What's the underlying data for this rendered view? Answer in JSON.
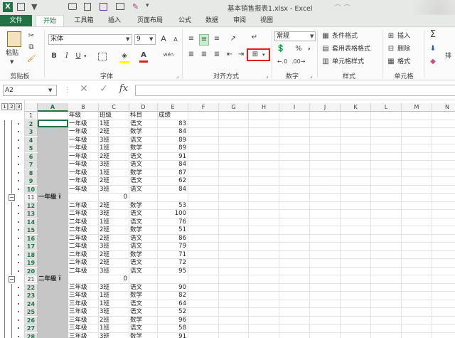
{
  "window": {
    "title": "基本销售报表1.xlsx - Excel",
    "app_icon": "X"
  },
  "ribbon_tabs": [
    "文件",
    "开始",
    "工具箱",
    "插入",
    "页面布局",
    "公式",
    "数据",
    "审阅",
    "视图"
  ],
  "ribbon": {
    "clipboard": {
      "paste": "粘贴",
      "label": "剪贴板"
    },
    "font": {
      "name": "宋体",
      "size": "9",
      "grow": "A",
      "shrink": "A",
      "bold": "B",
      "italic": "I",
      "underline": "U",
      "label": "字体",
      "phonetic": "wén"
    },
    "alignment": {
      "label": "对齐方式"
    },
    "number": {
      "format": "常规",
      "percent": "%",
      "comma": ",",
      "label": "数字"
    },
    "styles": {
      "conditional": "条件格式",
      "table": "套用表格格式",
      "cell_styles": "单元格样式",
      "label": "样式"
    },
    "cells": {
      "insert": "插入",
      "delete": "删除",
      "format": "格式",
      "label": "单元格"
    },
    "editing": {
      "sum": "Σ",
      "sort": "排"
    }
  },
  "formula_bar": {
    "name_box": "A2",
    "fx": "fx",
    "value": ""
  },
  "outline_levels": [
    "1",
    "2",
    "3"
  ],
  "columns": [
    "A",
    "B",
    "C",
    "D",
    "E",
    "F",
    "G",
    "H",
    "I",
    "J",
    "K",
    "L",
    "M",
    "N"
  ],
  "rows": [
    {
      "n": "1",
      "sel": false,
      "b": "年级",
      "c": "班级",
      "d": "科目",
      "e": "成绩",
      "a": ""
    },
    {
      "n": "2",
      "sel": true,
      "b": "一年级",
      "c": "1班",
      "d": "语文",
      "e": "83",
      "a": ""
    },
    {
      "n": "3",
      "sel": true,
      "b": "一年级",
      "c": "2班",
      "d": "数学",
      "e": "84",
      "a": ""
    },
    {
      "n": "4",
      "sel": true,
      "b": "一年级",
      "c": "3班",
      "d": "语文",
      "e": "89",
      "a": ""
    },
    {
      "n": "5",
      "sel": true,
      "b": "一年级",
      "c": "1班",
      "d": "数学",
      "e": "89",
      "a": ""
    },
    {
      "n": "6",
      "sel": true,
      "b": "一年级",
      "c": "2班",
      "d": "语文",
      "e": "91",
      "a": ""
    },
    {
      "n": "7",
      "sel": true,
      "b": "一年级",
      "c": "3班",
      "d": "语文",
      "e": "84",
      "a": ""
    },
    {
      "n": "8",
      "sel": true,
      "b": "一年级",
      "c": "1班",
      "d": "数学",
      "e": "87",
      "a": ""
    },
    {
      "n": "9",
      "sel": true,
      "b": "一年级",
      "c": "2班",
      "d": "语文",
      "e": "62",
      "a": ""
    },
    {
      "n": "10",
      "sel": true,
      "b": "一年级",
      "c": "3班",
      "d": "语文",
      "e": "84",
      "a": ""
    },
    {
      "n": "11",
      "sel": false,
      "b": "",
      "c": "0",
      "d": "",
      "e": "",
      "a": "一年级 ï"
    },
    {
      "n": "12",
      "sel": true,
      "b": "二年级",
      "c": "2班",
      "d": "数学",
      "e": "53",
      "a": ""
    },
    {
      "n": "13",
      "sel": true,
      "b": "二年级",
      "c": "3班",
      "d": "语文",
      "e": "100",
      "a": ""
    },
    {
      "n": "14",
      "sel": true,
      "b": "二年级",
      "c": "1班",
      "d": "语文",
      "e": "76",
      "a": ""
    },
    {
      "n": "15",
      "sel": true,
      "b": "二年级",
      "c": "2班",
      "d": "数学",
      "e": "51",
      "a": ""
    },
    {
      "n": "16",
      "sel": true,
      "b": "二年级",
      "c": "2班",
      "d": "语文",
      "e": "86",
      "a": ""
    },
    {
      "n": "17",
      "sel": true,
      "b": "二年级",
      "c": "3班",
      "d": "语文",
      "e": "79",
      "a": ""
    },
    {
      "n": "18",
      "sel": true,
      "b": "二年级",
      "c": "2班",
      "d": "数学",
      "e": "71",
      "a": ""
    },
    {
      "n": "19",
      "sel": true,
      "b": "二年级",
      "c": "2班",
      "d": "语文",
      "e": "72",
      "a": ""
    },
    {
      "n": "20",
      "sel": true,
      "b": "二年级",
      "c": "3班",
      "d": "语文",
      "e": "95",
      "a": ""
    },
    {
      "n": "21",
      "sel": false,
      "b": "",
      "c": "0",
      "d": "",
      "e": "",
      "a": "二年级 ï"
    },
    {
      "n": "22",
      "sel": true,
      "b": "三年级",
      "c": "3班",
      "d": "语文",
      "e": "90",
      "a": ""
    },
    {
      "n": "23",
      "sel": true,
      "b": "三年级",
      "c": "1班",
      "d": "数学",
      "e": "82",
      "a": ""
    },
    {
      "n": "24",
      "sel": true,
      "b": "三年级",
      "c": "1班",
      "d": "语文",
      "e": "64",
      "a": ""
    },
    {
      "n": "25",
      "sel": true,
      "b": "三年级",
      "c": "3班",
      "d": "语文",
      "e": "52",
      "a": ""
    },
    {
      "n": "26",
      "sel": true,
      "b": "三年级",
      "c": "2班",
      "d": "数学",
      "e": "96",
      "a": ""
    },
    {
      "n": "27",
      "sel": true,
      "b": "三年级",
      "c": "1班",
      "d": "语文",
      "e": "58",
      "a": ""
    },
    {
      "n": "28",
      "sel": true,
      "b": "三年级",
      "c": "3班",
      "d": "数学",
      "e": "91",
      "a": ""
    }
  ],
  "colors": {
    "excel_green": "#217346",
    "highlight_red": "#e0201b",
    "selection": "#c6c6c6"
  }
}
